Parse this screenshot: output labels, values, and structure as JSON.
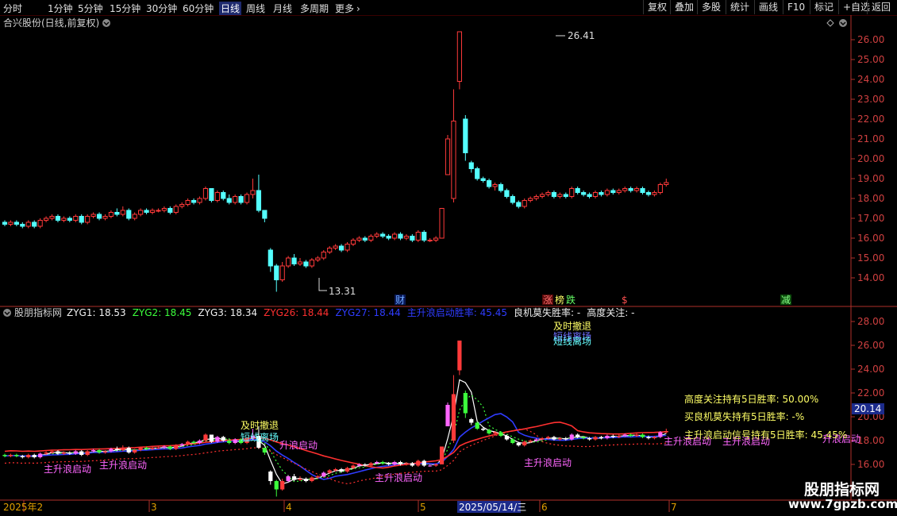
{
  "toolbar": {
    "timeframes": [
      "分时",
      "1分钟",
      "5分钟",
      "15分钟",
      "30分钟",
      "60分钟",
      "日线",
      "周线",
      "月线",
      "多周期",
      "更多"
    ],
    "active_timeframe": "日线",
    "more_arrow": "›",
    "right_buttons": [
      "复权",
      "叠加",
      "多股",
      "统计",
      "画线",
      "F10",
      "标记",
      "+自选",
      "返回"
    ]
  },
  "main_panel": {
    "title": "合兴股份(日线,前复权)",
    "high_label": "26.41",
    "low_label": "13.31",
    "price_ticks": [
      "26.00",
      "25.00",
      "24.00",
      "23.00",
      "22.00",
      "21.00",
      "20.00",
      "19.00",
      "18.00",
      "17.00",
      "16.00",
      "15.00",
      "14.00"
    ],
    "event_markers": [
      "财",
      "涨",
      "榜",
      "跌",
      "$",
      "减"
    ]
  },
  "indicator_panel": {
    "name": "股朋指标网",
    "values": [
      {
        "label": "ZYG1:",
        "value": "18.53",
        "color": "#f0f0f0"
      },
      {
        "label": "ZYG2:",
        "value": "18.45",
        "color": "#3cff3c"
      },
      {
        "label": "ZYG3:",
        "value": "18.34",
        "color": "#f0f0f0"
      },
      {
        "label": "ZYG26:",
        "value": "18.44",
        "color": "#ff3030"
      },
      {
        "label": "ZYG27:",
        "value": "18.44",
        "color": "#2f3cff"
      },
      {
        "label": "主升浪启动胜率:",
        "value": "45.45",
        "color": "#2f3cff"
      },
      {
        "label": "良机莫失胜率:",
        "value": "-",
        "color": "#f0f0f0"
      },
      {
        "label": "高度关注:",
        "value": "-",
        "color": "#f0f0f0"
      }
    ],
    "ticks": [
      "28.00",
      "26.00",
      "24.00",
      "22.00",
      "20.00",
      "18.00",
      "16.00"
    ],
    "current_value": "20.14",
    "stats": [
      "高度关注持有5日胜率: 50.00%",
      "买良机莫失持有5日胜率: -%",
      "主升浪启动信号持有5日胜率: 45.45%"
    ],
    "signals": {
      "retreat": "及时撤退",
      "short_exit": "短线离场",
      "launch": "主升浪启动",
      "launch_short": "升浪启动"
    }
  },
  "date_axis": {
    "labels": [
      "2025年2",
      "3",
      "4",
      "5",
      "6",
      "7"
    ],
    "cursor_date": "2025/05/14/三"
  },
  "watermark": {
    "title": "股朋指标网",
    "url": "www.7gpzb.com"
  },
  "colors": {
    "up": "#ff3a3a",
    "down": "#54ffff",
    "axis": "#b0302a",
    "grid": "#5a0000"
  }
}
